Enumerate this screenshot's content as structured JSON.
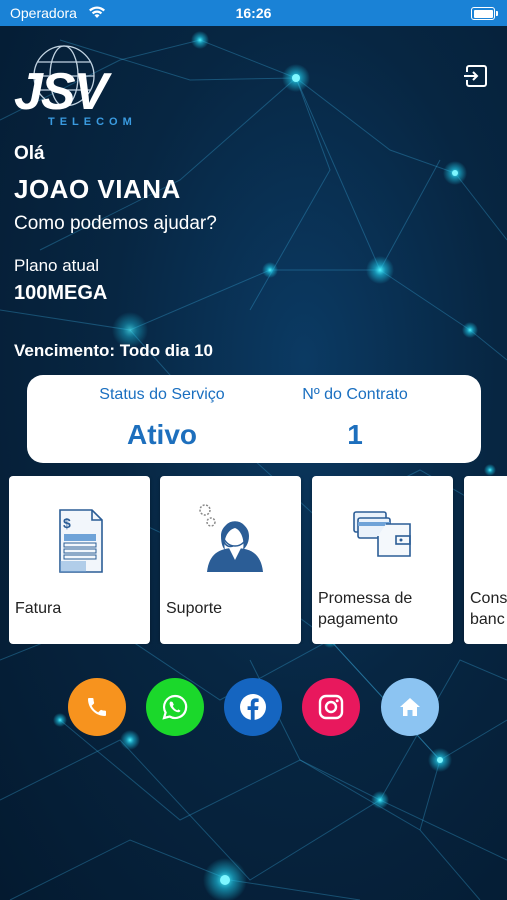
{
  "status_bar": {
    "carrier": "Operadora",
    "time": "16:26"
  },
  "brand": {
    "logo_main": "JSV",
    "logo_sub": "TELECOM"
  },
  "greeting": {
    "hello": "Olá",
    "user_name": "JOAO VIANA",
    "question": "Como podemos ajudar?"
  },
  "plan": {
    "label": "Plano atual",
    "value": "100MEGA",
    "due": "Vencimento: Todo dia 10"
  },
  "status_card": {
    "service_label": "Status do Serviço",
    "service_value": "Ativo",
    "contract_label": "Nº do Contrato",
    "contract_value": "1"
  },
  "tiles": [
    {
      "label": "Fatura",
      "icon": "invoice-icon"
    },
    {
      "label": "Suporte",
      "icon": "support-agent-icon"
    },
    {
      "label": "Promessa de pagamento",
      "icon": "wallet-cards-icon"
    },
    {
      "label": "Cons banc",
      "icon": "bank-icon"
    }
  ],
  "social": [
    {
      "name": "phone",
      "color": "#f7931e"
    },
    {
      "name": "whatsapp",
      "color": "#1bd82b"
    },
    {
      "name": "facebook",
      "color": "#1565c0"
    },
    {
      "name": "instagram",
      "color": "#e8185d"
    },
    {
      "name": "home",
      "color": "#8cc4f2"
    }
  ]
}
